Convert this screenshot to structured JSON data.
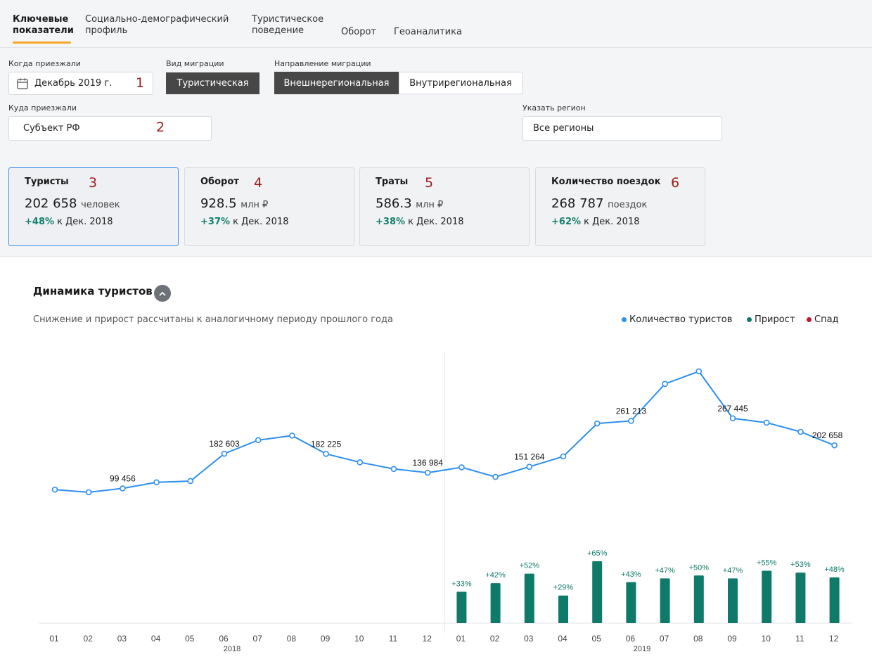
{
  "tabs": [
    {
      "label1": "Ключевые",
      "label2": "показатели"
    },
    {
      "label1": "Социально-демографический",
      "label2": "профиль"
    },
    {
      "label1": "Туристическое",
      "label2": "поведение"
    },
    {
      "label1": "Оборот",
      "label2": ""
    },
    {
      "label1": "Геоаналитика",
      "label2": ""
    }
  ],
  "filters": {
    "when_label": "Когда приезжали",
    "when_value": "Декабрь 2019 г.",
    "migration_type_label": "Вид миграции",
    "migration_type_value": "Туристическая",
    "direction_label": "Направление миграции",
    "direction_options": [
      "Внешнерегиональная",
      "Внутрирегиональная"
    ],
    "where_label": "Куда приезжали",
    "where_value": "Субъект РФ",
    "region_label": "Указать регион",
    "region_value": "Все регионы"
  },
  "annotations": [
    "1",
    "2",
    "3",
    "4",
    "5",
    "6"
  ],
  "cards": [
    {
      "title": "Туристы",
      "value": "202 658",
      "unit": "человек",
      "delta": "+48%",
      "compare": "к Дек. 2018"
    },
    {
      "title": "Оборот",
      "value": "928.5",
      "unit": "млн ₽",
      "delta": "+37%",
      "compare": "к Дек. 2018"
    },
    {
      "title": "Траты",
      "value": "586.3",
      "unit": "млн ₽",
      "delta": "+38%",
      "compare": "к Дек. 2018"
    },
    {
      "title": "Количество поездок",
      "value": "268 787",
      "unit": "поездок",
      "delta": "+62%",
      "compare": "к Дек. 2018"
    }
  ],
  "chart": {
    "title": "Динамика туристов",
    "subtitle": "Снижение и прирост рассчитаны к аналогичному периоду прошлого года",
    "legend": [
      {
        "label": "Количество туристов",
        "color": "#2f8ff0"
      },
      {
        "label": "Прирост",
        "color": "#0f7a6a"
      },
      {
        "label": "Спад",
        "color": "#c0182f"
      }
    ]
  },
  "chart_data": {
    "type": "line",
    "x": [
      "01",
      "02",
      "03",
      "04",
      "05",
      "06",
      "07",
      "08",
      "09",
      "10",
      "11",
      "12",
      "01",
      "02",
      "03",
      "04",
      "05",
      "06",
      "07",
      "08",
      "09",
      "10",
      "11",
      "12"
    ],
    "year_labels": [
      "2018",
      "2019"
    ],
    "series": [
      {
        "name": "Количество туристов",
        "color": "#2f8ff0",
        "values": [
          96500,
          90000,
          99456,
          114000,
          117000,
          182603,
          215000,
          226000,
          182225,
          162000,
          146000,
          136984,
          150000,
          127000,
          151264,
          176000,
          255000,
          261213,
          350000,
          380000,
          267445,
          257000,
          235000,
          202658
        ]
      },
      {
        "name": "Прирост",
        "color": "#0f7a6a",
        "type": "bar",
        "values": [
          null,
          null,
          null,
          null,
          null,
          null,
          null,
          null,
          null,
          null,
          null,
          null,
          33,
          42,
          52,
          29,
          65,
          43,
          47,
          50,
          47,
          55,
          53,
          48
        ]
      }
    ],
    "point_labels": {
      "2": "99 456",
      "5": "182 603",
      "8": "182 225",
      "11": "136 984",
      "14": "151 264",
      "17": "261 213",
      "20": "267 445",
      "23": "202 658"
    },
    "bar_labels": [
      "+33%",
      "+42%",
      "+52%",
      "+29%",
      "+65%",
      "+43%",
      "+47%",
      "+50%",
      "+47%",
      "+55%",
      "+53%",
      "+48%"
    ]
  }
}
